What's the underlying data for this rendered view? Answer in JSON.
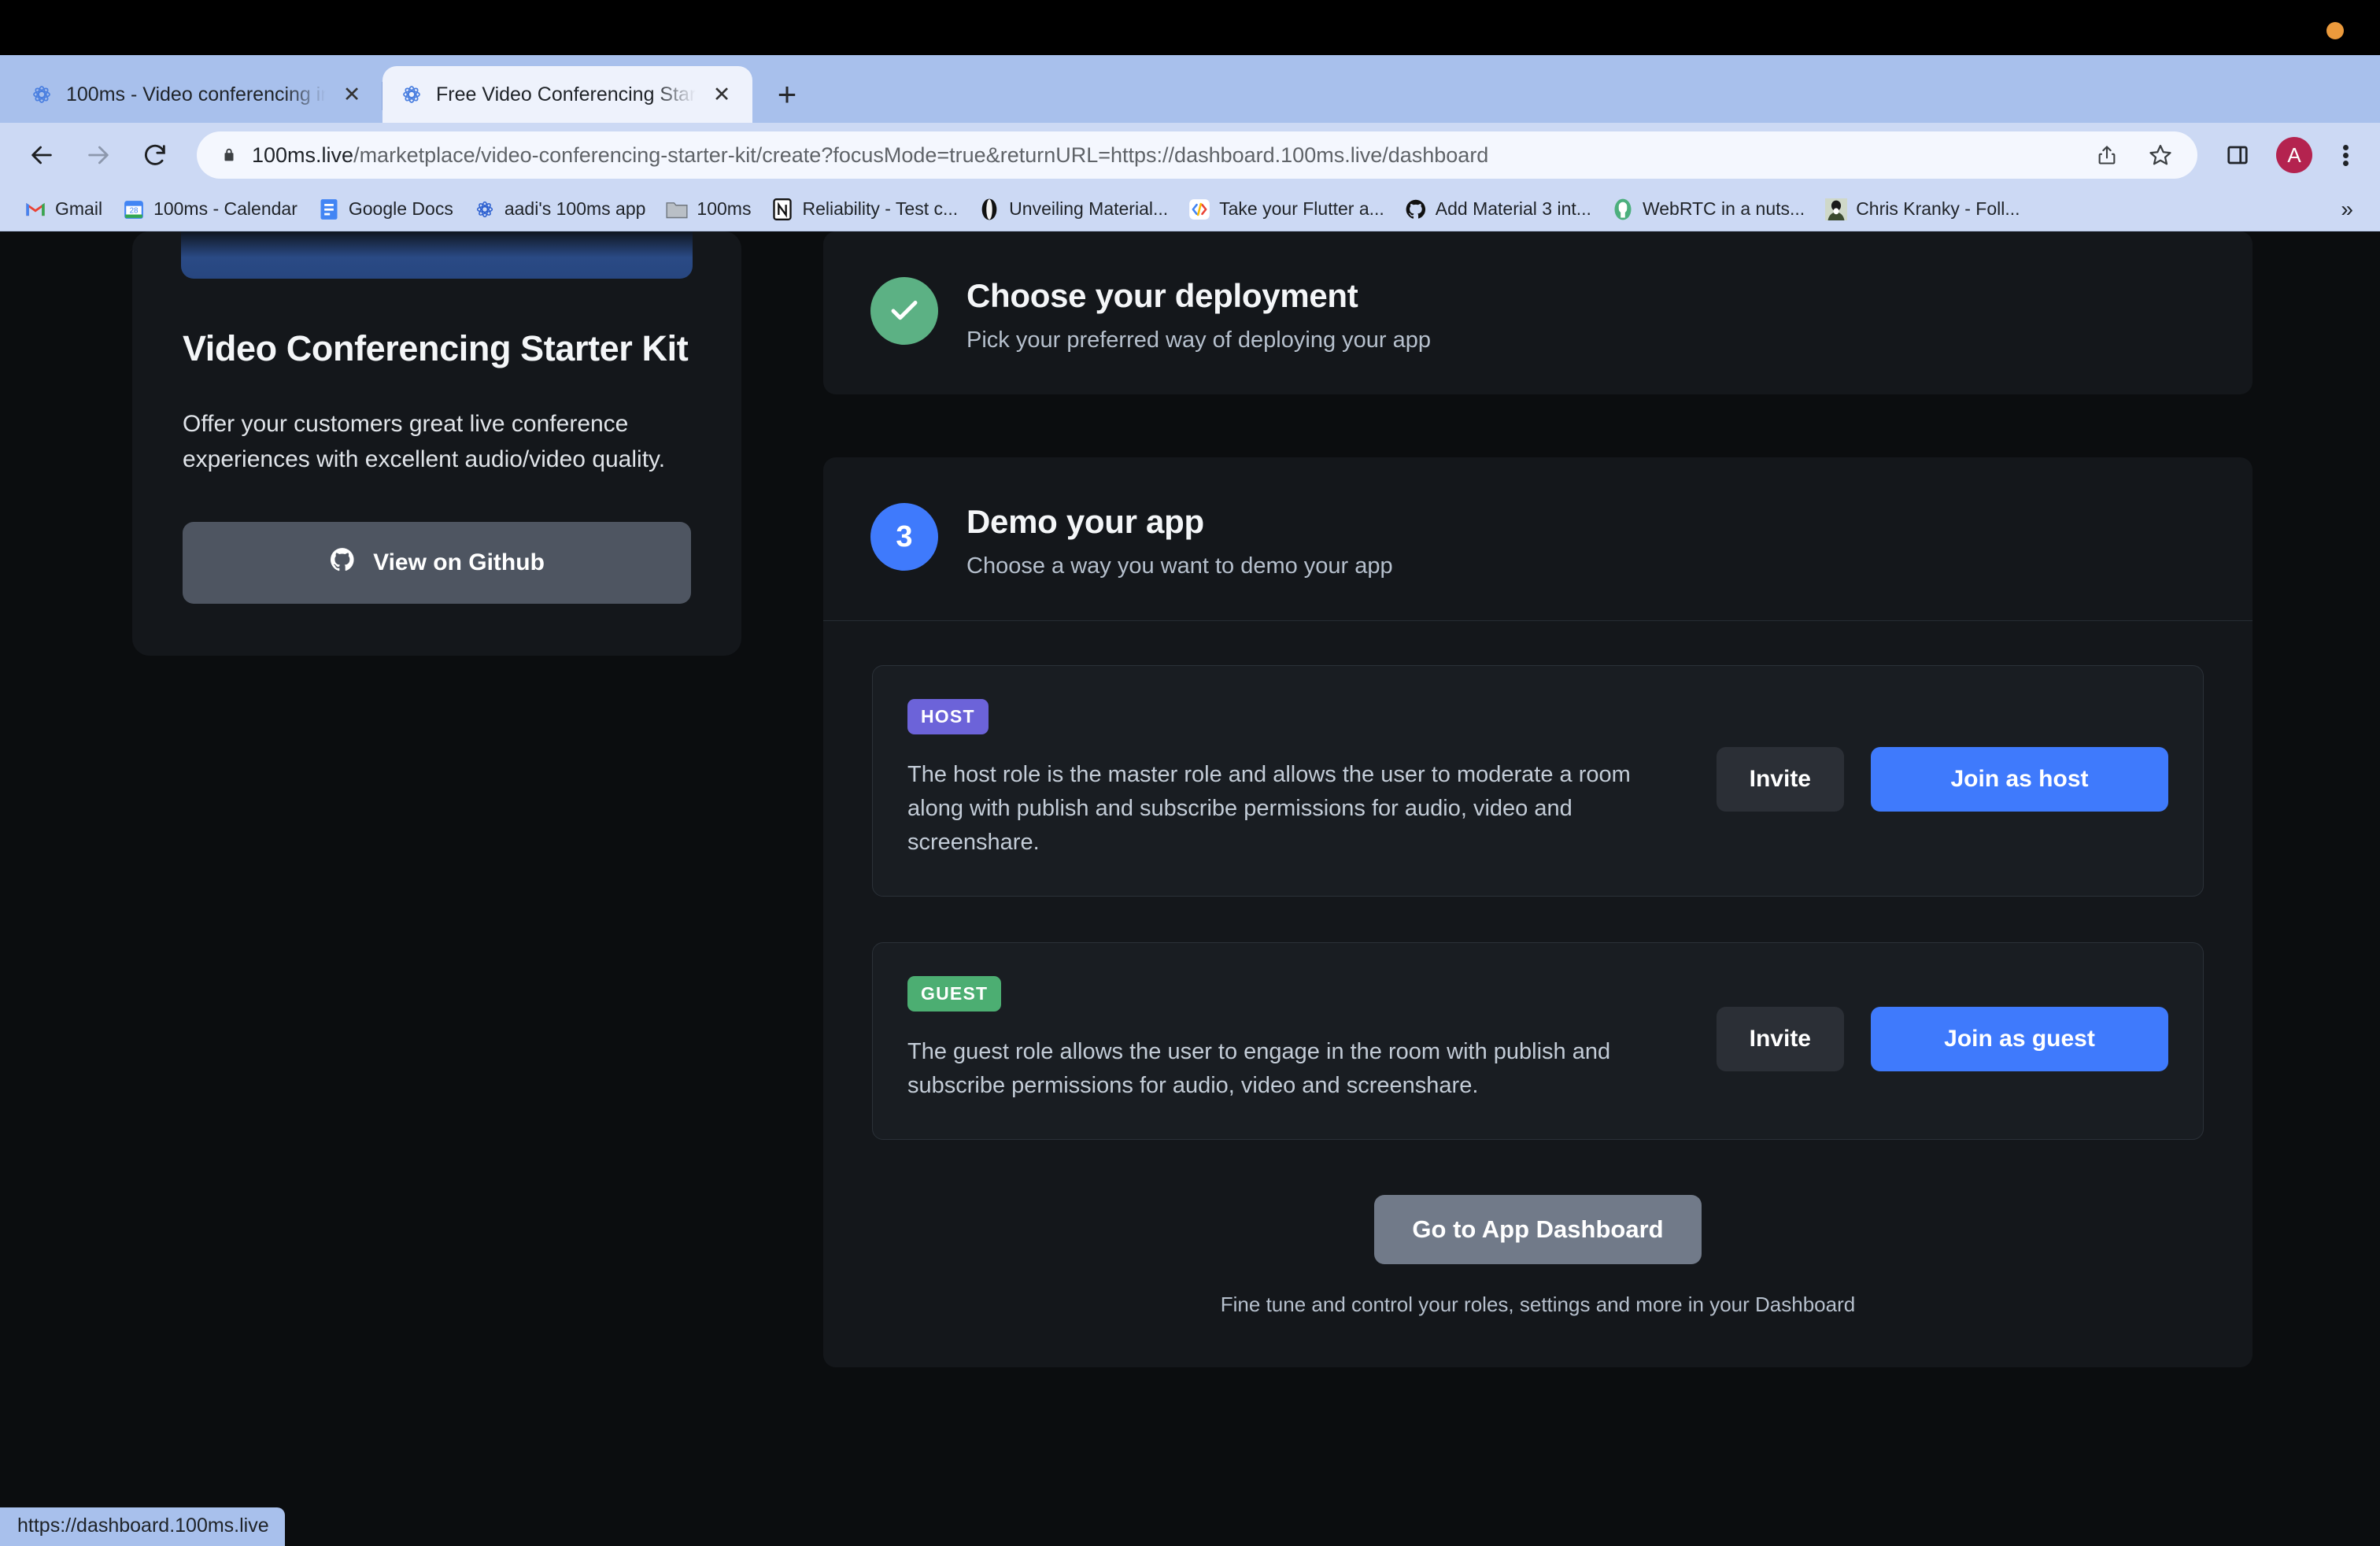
{
  "browser": {
    "tabs": [
      {
        "title": "100ms - Video conferencing int",
        "favicon": "100ms-icon",
        "active": false,
        "close_label": "✕"
      },
      {
        "title": "Free Video Conferencing Starte",
        "favicon": "100ms-icon",
        "active": true,
        "close_label": "✕"
      }
    ],
    "new_tab_label": "+",
    "omnibox": {
      "url_host": "100ms.live",
      "url_path": "/marketplace/video-conferencing-starter-kit/create?focusMode=true&returnURL=https://dashboard.100ms.live/dashboard",
      "lock_icon": "lock-icon",
      "share_icon": "share-icon",
      "bookmark_icon": "star-icon"
    },
    "toolbar": {
      "back_icon": "back-arrow-icon",
      "forward_icon": "forward-arrow-icon",
      "reload_icon": "reload-icon",
      "sidepanel_icon": "side-panel-icon",
      "avatar_letter": "A",
      "menu_icon": "kebab-menu-icon"
    },
    "bookmarks": [
      {
        "label": "Gmail",
        "icon": "gmail-icon"
      },
      {
        "label": "100ms - Calendar",
        "icon": "google-calendar-icon"
      },
      {
        "label": "Google Docs",
        "icon": "google-docs-icon"
      },
      {
        "label": "aadi's 100ms app",
        "icon": "100ms-icon"
      },
      {
        "label": "100ms",
        "icon": "folder-icon"
      },
      {
        "label": "Reliability - Test c...",
        "icon": "notion-icon"
      },
      {
        "label": "Unveiling Material...",
        "icon": "medium-icon"
      },
      {
        "label": "Take your Flutter a...",
        "icon": "google-dev-icon"
      },
      {
        "label": "Add Material 3 int...",
        "icon": "github-icon"
      },
      {
        "label": "WebRTC in a nuts...",
        "icon": "webrtc-icon"
      },
      {
        "label": "Chris Kranky - Foll...",
        "icon": "avatar-photo-icon"
      }
    ],
    "bookmarks_overflow_label": "»",
    "status_url": "https://dashboard.100ms.live"
  },
  "promo": {
    "title": "Video Conferencing Starter Kit",
    "description": "Offer your customers great live conference experiences with excellent audio/video quality.",
    "github_button": "View on Github",
    "github_icon": "github-icon"
  },
  "steps": [
    {
      "badge": "✓",
      "badge_state": "done",
      "title": "Choose your deployment",
      "subtitle": "Pick your preferred way of deploying your app"
    },
    {
      "badge": "3",
      "badge_state": "active",
      "title": "Demo your app",
      "subtitle": "Choose a way you want to demo your app"
    }
  ],
  "roles": [
    {
      "chip": "HOST",
      "chip_color": "#6c63d9",
      "description": "The host role is the master role and allows the user to moderate a room along with publish and subscribe permissions for audio, video and screenshare.",
      "invite_label": "Invite",
      "join_label": "Join as host"
    },
    {
      "chip": "GUEST",
      "chip_color": "#4cae72",
      "description": "The guest role allows the user to engage in the room with publish and subscribe permissions for audio, video and screenshare.",
      "invite_label": "Invite",
      "join_label": "Join as guest"
    }
  ],
  "dashboard": {
    "button_label": "Go to App Dashboard",
    "note": "Fine tune and control your roles, settings and more in your Dashboard"
  },
  "colors": {
    "accent_blue": "#3f7afc",
    "success_green": "#5cb184",
    "host_purple": "#6c63d9",
    "guest_green": "#4cae72",
    "page_bg": "#0b0d0f",
    "card_bg": "#14171b"
  }
}
